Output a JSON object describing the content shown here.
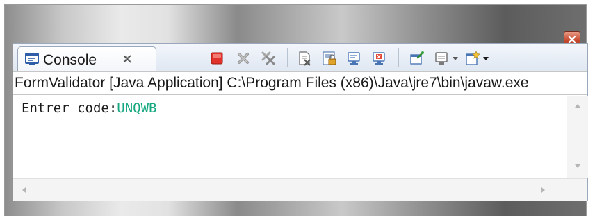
{
  "console": {
    "tab_label": "Console",
    "tab_icon": "console-icon",
    "launch_path": "FormValidator [Java Application] C:\\Program Files (x86)\\Java\\jre7\\bin\\javaw.exe",
    "prompt": "Entrer code:",
    "user_input": "UNQWB"
  },
  "toolbar": [
    "terminate-icon",
    "remove-launch-icon",
    "remove-all-terminated-icon",
    "clear-console-icon",
    "scroll-lock-icon",
    "show-on-stdout-icon",
    "show-on-stderr-icon",
    "pin-console-icon",
    "display-console-icon",
    "open-console-icon"
  ],
  "colors": {
    "input_text": "#17a882",
    "terminate_red": "#e0312a",
    "panel_border": "#99a8bb"
  }
}
